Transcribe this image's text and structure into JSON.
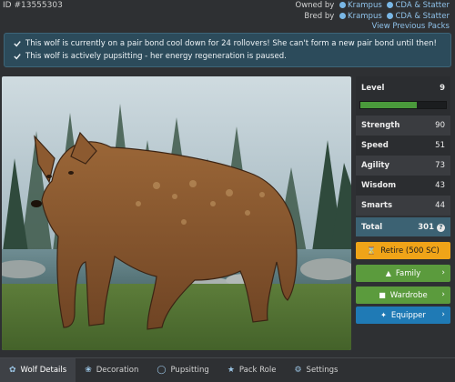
{
  "header": {
    "wolf_id": "ID #13555303",
    "owned_by_label": "Owned by",
    "bred_by_label": "Bred by",
    "owner_1": "Krampus",
    "owner_2": "CDA & Statter",
    "breeder_1": "Krampus",
    "breeder_2": "CDA & Statter",
    "view_previous": "View Previous Packs"
  },
  "alerts": [
    "This wolf is currently on a pair bond cool down for 24 rollovers! She can't form a new pair bond until then!",
    "This wolf is actively pupsitting - her energy regeneration is paused."
  ],
  "stats": {
    "level_label": "Level",
    "level_value": "9",
    "xp_fraction": 0.66,
    "strength_label": "Strength",
    "strength": "90",
    "speed_label": "Speed",
    "speed": "51",
    "agility_label": "Agility",
    "agility": "73",
    "wisdom_label": "Wisdom",
    "wisdom": "43",
    "smarts_label": "Smarts",
    "smarts": "44",
    "total_label": "Total",
    "total": "301"
  },
  "buttons": {
    "retire": "Retire (500 SC)",
    "family": "Family",
    "wardrobe": "Wardrobe",
    "equipper": "Equipper"
  },
  "tabs": [
    {
      "label": "Wolf Details",
      "icon": "paw-icon"
    },
    {
      "label": "Decoration",
      "icon": "feather-icon"
    },
    {
      "label": "Pupsitting",
      "icon": "shield-icon"
    },
    {
      "label": "Pack Role",
      "icon": "star-icon"
    },
    {
      "label": "Settings",
      "icon": "gear-icon"
    }
  ],
  "colors": {
    "alert_bg": "#2c4b5b",
    "retire": "#f0a418",
    "green_button": "#5b9b3d",
    "blue_button": "#1f7ab5",
    "total_bg": "#3c6273",
    "xp": "#4a9a3b"
  }
}
